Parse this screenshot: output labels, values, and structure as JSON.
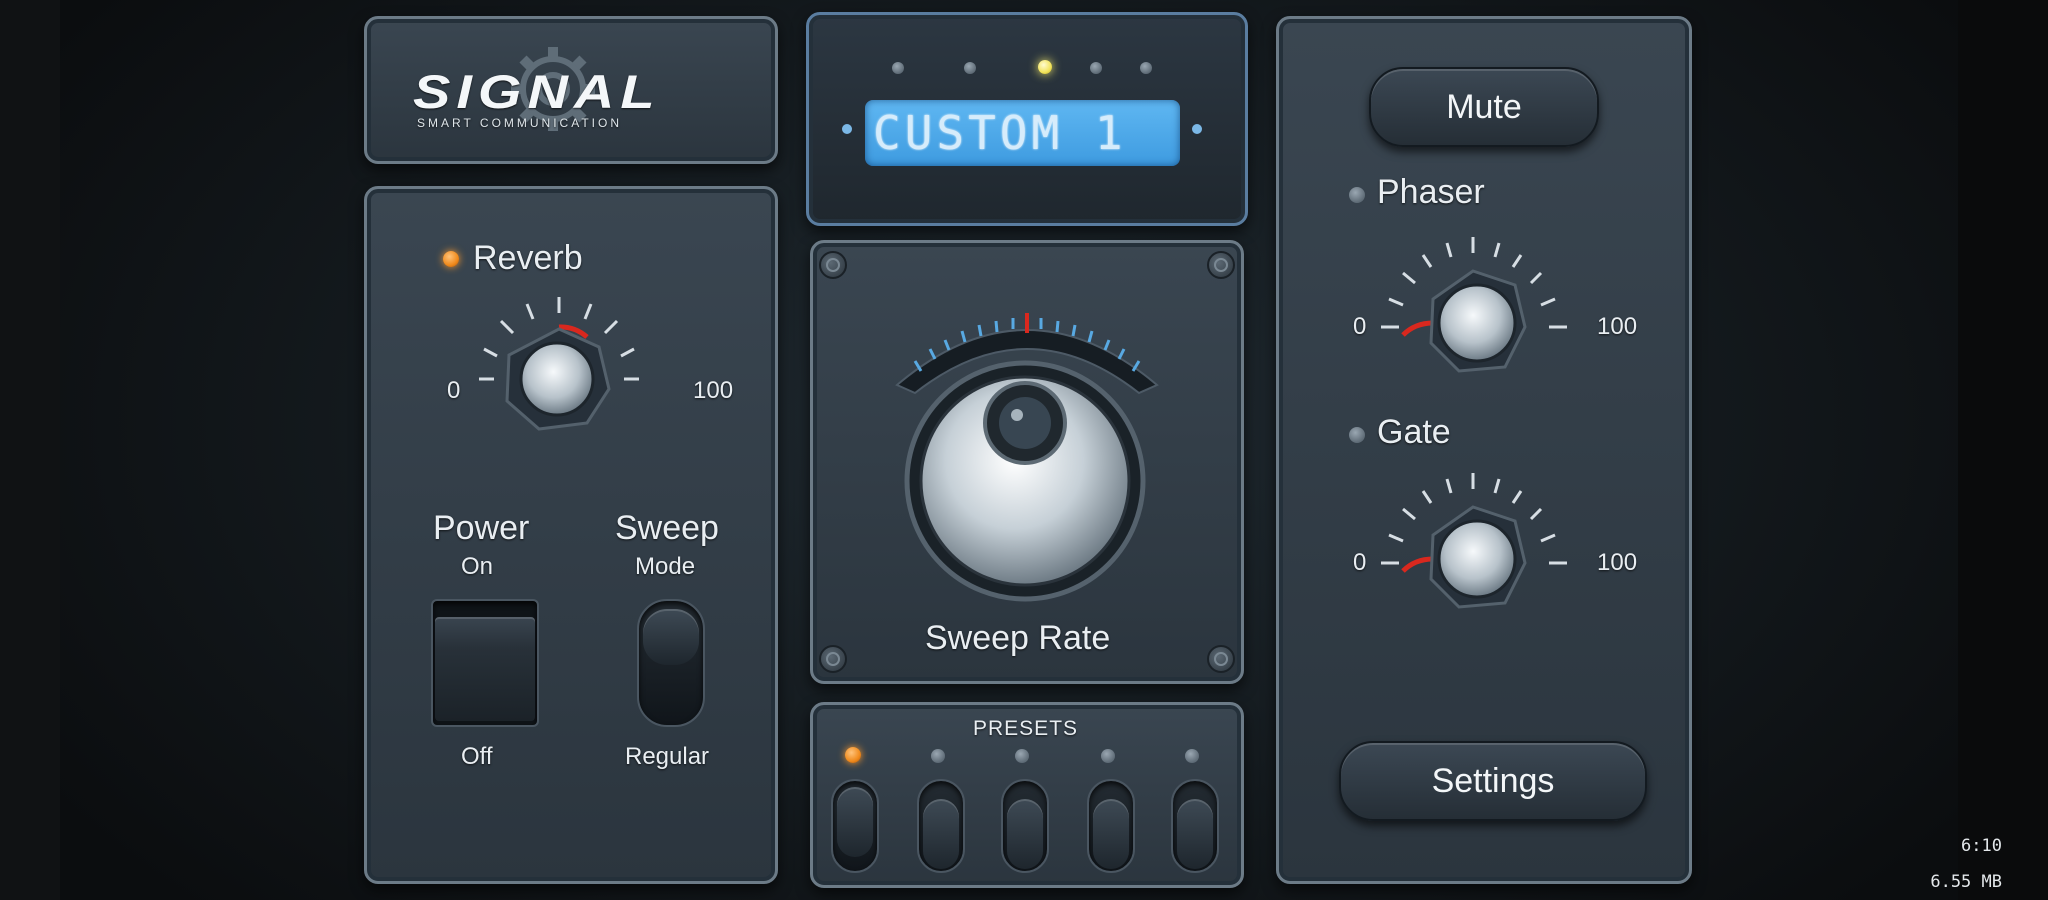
{
  "brand": {
    "name": "SIGNAL",
    "tagline": "SMART COMMUNICATION"
  },
  "display": {
    "preset_name": "CUSTOM 1",
    "dot_count": 5,
    "active_dot": 3
  },
  "reverb": {
    "label": "Reverb",
    "min": "0",
    "max": "100",
    "level_percent": 62,
    "led": "on"
  },
  "power": {
    "label": "Power",
    "on_label": "On",
    "off_label": "Off",
    "state": "off"
  },
  "sweep_mode": {
    "label": "Sweep",
    "sub": "Mode",
    "alt": "Regular",
    "state": "regular"
  },
  "sweep_rate": {
    "label": "Sweep Rate"
  },
  "presets": {
    "title": "PRESETS",
    "count": 5,
    "active": 1
  },
  "mute": {
    "label": "Mute"
  },
  "phaser": {
    "label": "Phaser",
    "min": "0",
    "max": "100",
    "level_percent": 10,
    "led": "off"
  },
  "gate": {
    "label": "Gate",
    "min": "0",
    "max": "100",
    "level_percent": 10,
    "led": "off"
  },
  "settings": {
    "label": "Settings"
  },
  "status_bar": {
    "time": "6:10",
    "memory": "6.55 MB"
  },
  "colors": {
    "accent_orange": "#f08a1c",
    "lcd_blue": "#4aa6e8",
    "indicator_red": "#d9281e",
    "panel": "#323d47"
  }
}
